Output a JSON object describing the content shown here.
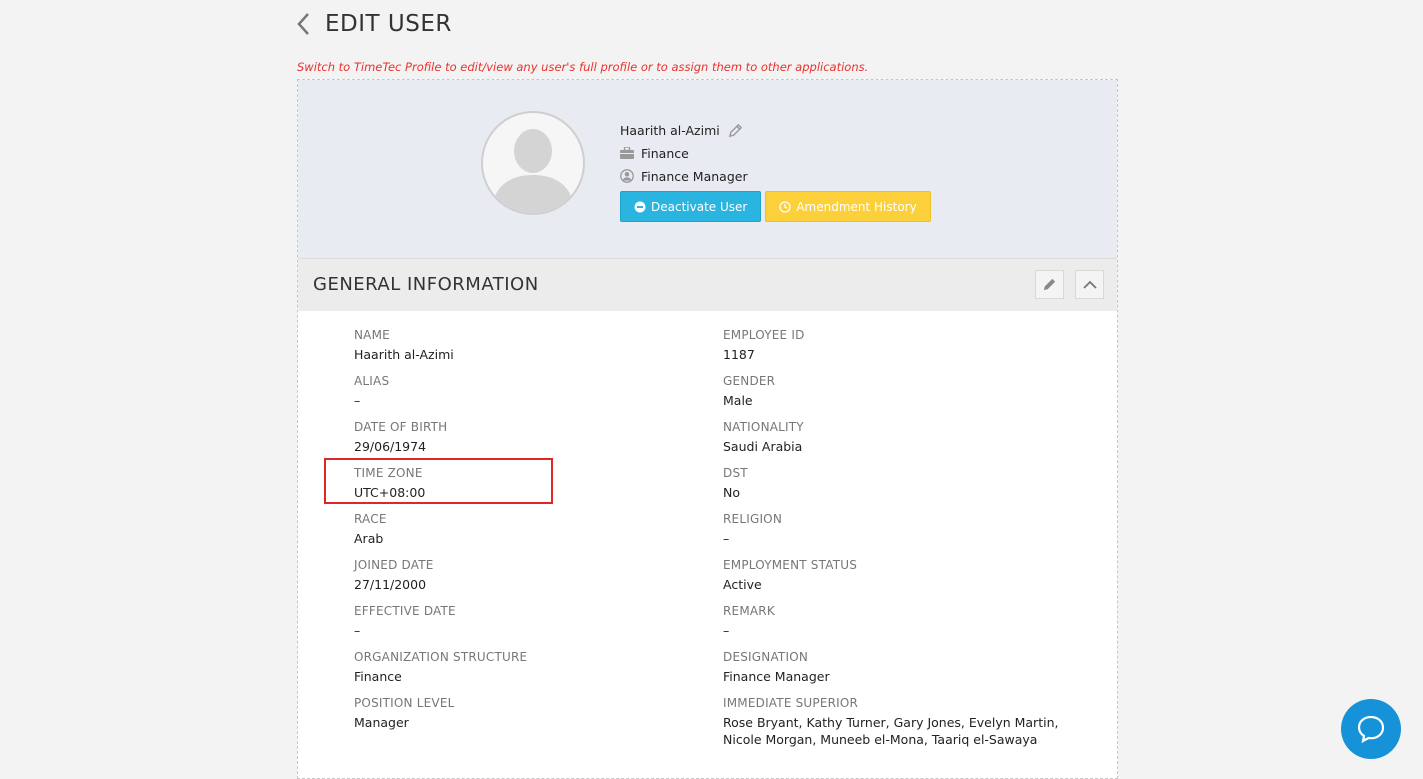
{
  "header": {
    "title": "EDIT USER"
  },
  "notice": "Switch to TimeTec Profile to edit/view any user's full profile or to assign them to other applications.",
  "profile": {
    "name": "Haarith al-Azimi",
    "department": "Finance",
    "position": "Finance Manager",
    "deactivate_label": "Deactivate User",
    "amendment_label": "Amendment History"
  },
  "general": {
    "title": "GENERAL INFORMATION",
    "left": [
      {
        "label": "NAME",
        "value": "Haarith al-Azimi"
      },
      {
        "label": "ALIAS",
        "value": "–"
      },
      {
        "label": "DATE OF BIRTH",
        "value": "29/06/1974"
      },
      {
        "label": "TIME ZONE",
        "value": "UTC+08:00"
      },
      {
        "label": "RACE",
        "value": "Arab"
      },
      {
        "label": "JOINED DATE",
        "value": "27/11/2000"
      },
      {
        "label": "EFFECTIVE DATE",
        "value": "–"
      },
      {
        "label": "ORGANIZATION STRUCTURE",
        "value": "Finance"
      },
      {
        "label": "POSITION LEVEL",
        "value": "Manager"
      }
    ],
    "right": [
      {
        "label": "EMPLOYEE ID",
        "value": "1187"
      },
      {
        "label": "GENDER",
        "value": "Male"
      },
      {
        "label": "NATIONALITY",
        "value": "Saudi Arabia"
      },
      {
        "label": "DST",
        "value": "No"
      },
      {
        "label": "RELIGION",
        "value": "–"
      },
      {
        "label": "EMPLOYMENT STATUS",
        "value": "Active"
      },
      {
        "label": "REMARK",
        "value": "–"
      },
      {
        "label": "DESIGNATION",
        "value": "Finance Manager"
      },
      {
        "label": "IMMEDIATE SUPERIOR",
        "value": "Rose Bryant, Kathy Turner, Gary Jones, Evelyn Martin,",
        "value2": "Nicole Morgan, Muneeb el-Mona, Taariq el-Sawaya"
      }
    ]
  },
  "colors": {
    "accent_blue": "#2ab4e0",
    "accent_yellow": "#fcd03a",
    "notice_red": "#e8322f",
    "chat_blue": "#1693d8"
  },
  "icons": [
    "chevron-left-icon",
    "pencil-icon",
    "briefcase-icon",
    "user-circle-icon",
    "minus-circle-icon",
    "clock-icon",
    "chevron-up-icon",
    "chat-icon"
  ]
}
